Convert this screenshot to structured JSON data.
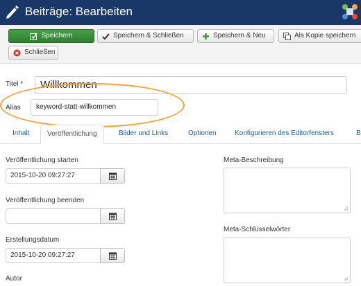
{
  "header": {
    "title": "Beiträge: Bearbeiten"
  },
  "toolbar": {
    "save_label": "Speichern",
    "save_close_label": "Speichern & Schließen",
    "save_new_label": "Speichern & Neu",
    "save_copy_label": "Als Kopie speichern",
    "close_label": "Schließen"
  },
  "form": {
    "title_label": "Titel *",
    "title_value": "Willkommen",
    "alias_label": "Alias",
    "alias_value": "keyword-statt-willkommen"
  },
  "tabs": [
    {
      "label": "Inhalt"
    },
    {
      "label": "Veröffentlichung"
    },
    {
      "label": "Bilder und Links"
    },
    {
      "label": "Optionen"
    },
    {
      "label": "Konfigurieren des Editorfensters"
    },
    {
      "label": "B"
    }
  ],
  "publishing": {
    "start_label": "Veröffentlichung starten",
    "start_value": "2015-10-20 09:27:27",
    "end_label": "Veröffentlichung beenden",
    "end_value": "",
    "created_label": "Erstellungsdatum",
    "created_value": "2015-10-20 09:27:27",
    "author_label": "Autor"
  },
  "meta": {
    "description_label": "Meta-Beschreibung",
    "keywords_label": "Meta-Schlüsselwörter"
  },
  "colors": {
    "header_bg": "#1a3867",
    "save_green": "#3d8f3c",
    "link_blue": "#1a5c98",
    "highlight_orange": "#f0a235"
  },
  "icons": [
    "pencil-icon",
    "joomla-logo-icon",
    "checkbox-edit-icon",
    "check-icon",
    "plus-icon",
    "copy-icon",
    "close-circle-icon",
    "calendar-icon"
  ]
}
